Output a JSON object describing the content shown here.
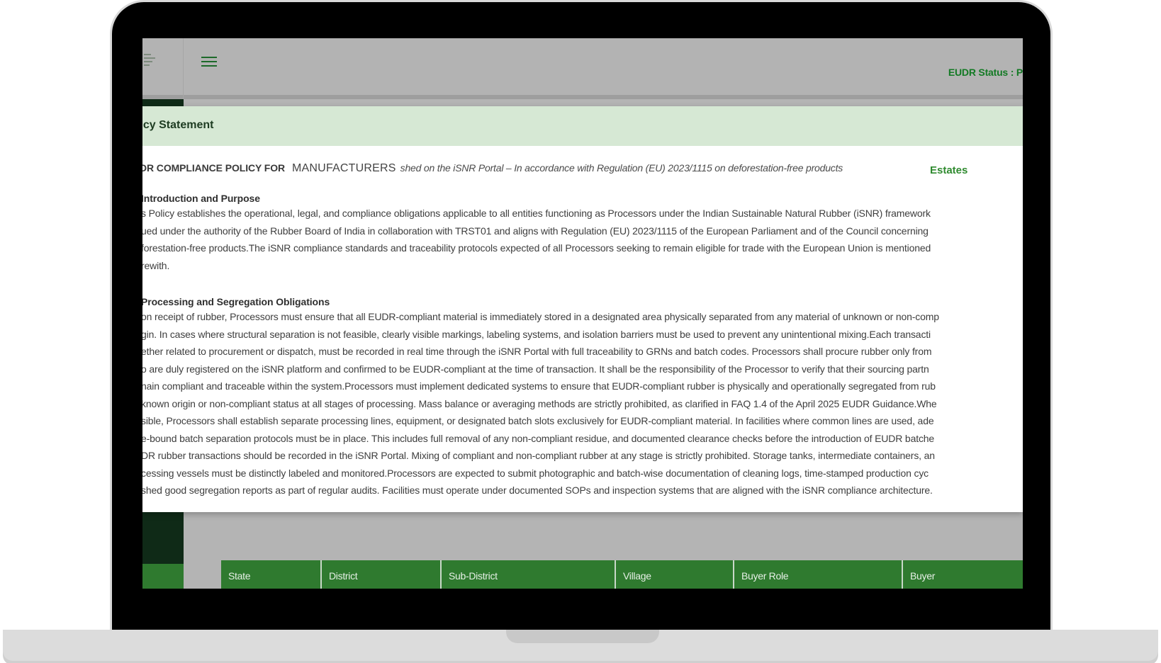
{
  "header": {
    "eudr_status": "EUDR Status : P"
  },
  "modal": {
    "title": "licy Statement",
    "policy_prefix": "DR COMPLIANCE POLICY FOR",
    "policy_role": "MANUFACTURERS",
    "policy_description": "shed on the iSNR Portal – In accordance with Regulation (EU) 2023/1115 on deforestation-free products",
    "estates_link": "Estates",
    "section1": {
      "heading": "Introduction and Purpose",
      "lines": [
        "s Policy establishes the operational, legal, and compliance obligations applicable to all entities functioning as Processors under the Indian Sustainable Natural Rubber (iSNR) framework",
        "ued under the authority of the Rubber Board of India in collaboration with TRST01 and aligns with Regulation (EU) 2023/1115 of the European Parliament and of the Council concerning",
        "forestation-free products.The iSNR compliance standards and traceability protocols expected of all Processors seeking to remain eligible for trade with the European Union is mentioned",
        "rewith."
      ]
    },
    "section2": {
      "heading": "Processing and Segregation Obligations",
      "lines": [
        "on receipt of rubber, Processors must ensure that all EUDR-compliant material is immediately stored in a designated area physically separated from any material of unknown or non-comp",
        "gin. In cases where structural separation is not feasible, clearly visible markings, labeling systems, and isolation barriers must be used to prevent any unintentional mixing.Each transacti",
        "ether related to procurement or dispatch, must be recorded in real time through the iSNR Portal with full traceability to GRNs and batch codes. Processors shall procure rubber only from",
        "o are duly registered on the iSNR platform and confirmed to be EUDR-compliant at the time of transaction. It shall be the responsibility of the Processor to verify that their sourcing partn",
        "nain compliant and traceable within the system.Processors must implement dedicated systems to ensure that EUDR-compliant rubber is physically and operationally segregated from rub",
        "known origin or non-compliant status at all stages of processing. Mass balance or averaging methods are strictly prohibited, as clarified in FAQ 1.4 of the April 2025 EUDR Guidance.Whe",
        "sible, Processors shall establish separate processing lines, equipment, or designated batch slots exclusively for EUDR-compliant material. In facilities where common lines are used, ade",
        "e-bound batch separation protocols must be in place. This includes full removal of any non-compliant residue, and documented clearance checks before the introduction of EUDR batche",
        "DR rubber transactions should be recorded in the iSNR Portal. Mixing of compliant and non-compliant rubber at any stage is strictly prohibited. Storage tanks, intermediate containers, an",
        "cessing vessels must be distinctly labeled and monitored.Processors are expected to submit photographic and batch-wise documentation of cleaning logs, time-stamped production cyc",
        "shed good segregation reports as part of regular audits. Facilities must operate under documented SOPs and inspection systems that are aligned with the iSNR compliance architecture."
      ]
    }
  },
  "table": {
    "columns": [
      "State",
      "District",
      "Sub-District",
      "Village",
      "Buyer Role",
      "Buyer"
    ]
  },
  "colors": {
    "brand_green": "#2f7a2f",
    "status_green": "#137a24",
    "modal_header_bg": "#d6e8d4"
  },
  "icons": {
    "menu": "hamburger-menu-icon",
    "logo": "rubber-board-logo"
  }
}
